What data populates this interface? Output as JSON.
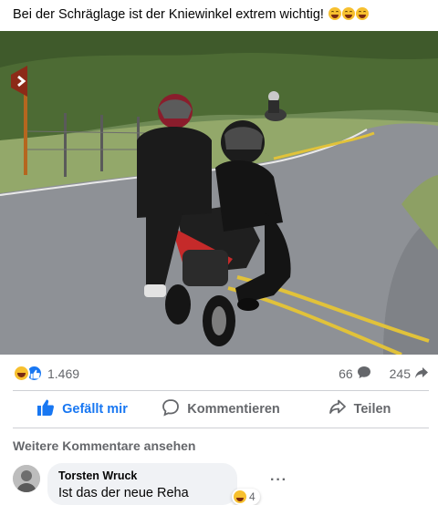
{
  "post": {
    "text": "Bei der Schräglage ist der Kniewinkel extrem wichtig!",
    "emoji_icons": [
      "laughing-tears-icon",
      "laughing-tears-icon",
      "laughing-tears-icon"
    ]
  },
  "photo": {
    "icon": "motorcycle-photo"
  },
  "stats": {
    "reaction_icons": [
      "haha-reaction-icon",
      "like-reaction-icon"
    ],
    "reaction_count": "1.469",
    "comment_count": "66",
    "share_count": "245"
  },
  "actions": {
    "like_label": "Gefällt mir",
    "comment_label": "Kommentieren",
    "share_label": "Teilen"
  },
  "more_comments_label": "Weitere Kommentare ansehen",
  "comment": {
    "author": "Torsten Wruck",
    "text": "Ist das der neue Reha Sport!?",
    "reaction_count": "4",
    "more_options": "···"
  },
  "colors": {
    "accent": "#1877f2",
    "muted": "#65676b",
    "bubble": "#f0f2f5",
    "haha": "#f7c02f"
  }
}
